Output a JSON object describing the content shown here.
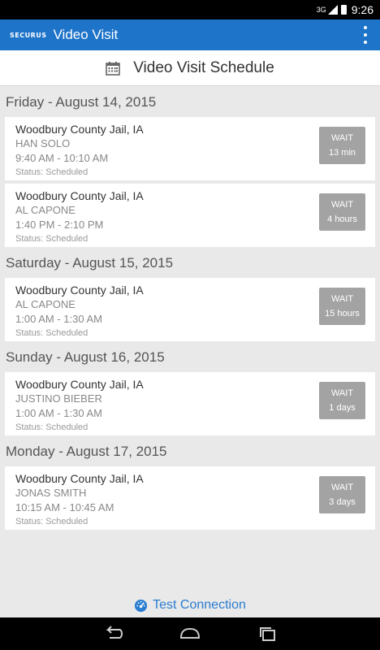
{
  "status_bar": {
    "signal": "3G",
    "time": "9:26"
  },
  "app_bar": {
    "logo": "SECURUS",
    "title": "Video Visit",
    "menu_icon": "overflow-menu-icon"
  },
  "page_header": {
    "icon": "calendar-icon",
    "title": "Video Visit Schedule"
  },
  "days": [
    {
      "label": "Friday - August 14, 2015",
      "visits": [
        {
          "facility": "Woodbury County Jail, IA",
          "name": "HAN SOLO",
          "time": "9:40 AM - 10:10 AM",
          "status": "Status: Scheduled",
          "wait_label": "WAIT",
          "wait_value": "13 min"
        },
        {
          "facility": "Woodbury County Jail, IA",
          "name": "AL CAPONE",
          "time": "1:40 PM - 2:10 PM",
          "status": "Status: Scheduled",
          "wait_label": "WAIT",
          "wait_value": "4 hours"
        }
      ]
    },
    {
      "label": "Saturday - August 15, 2015",
      "visits": [
        {
          "facility": "Woodbury County Jail, IA",
          "name": "AL CAPONE",
          "time": "1:00 AM - 1:30 AM",
          "status": "Status: Scheduled",
          "wait_label": "WAIT",
          "wait_value": "15 hours"
        }
      ]
    },
    {
      "label": "Sunday - August 16, 2015",
      "visits": [
        {
          "facility": "Woodbury County Jail, IA",
          "name": "JUSTINO BIEBER",
          "time": "1:00 AM - 1:30 AM",
          "status": "Status: Scheduled",
          "wait_label": "WAIT",
          "wait_value": "1 days"
        }
      ]
    },
    {
      "label": "Monday - August 17, 2015",
      "visits": [
        {
          "facility": "Woodbury County Jail, IA",
          "name": "JONAS SMITH",
          "time": "10:15 AM - 10:45 AM",
          "status": "Status: Scheduled",
          "wait_label": "WAIT",
          "wait_value": "3 days"
        }
      ]
    }
  ],
  "footer": {
    "icon": "speedometer-icon",
    "test_connection": "Test Connection"
  },
  "nav": {
    "back": "back-icon",
    "home": "home-icon",
    "recents": "recents-icon"
  },
  "colors": {
    "accent": "#1e74c9",
    "wait_button": "#a3a3a3",
    "link": "#2a7dd1"
  }
}
